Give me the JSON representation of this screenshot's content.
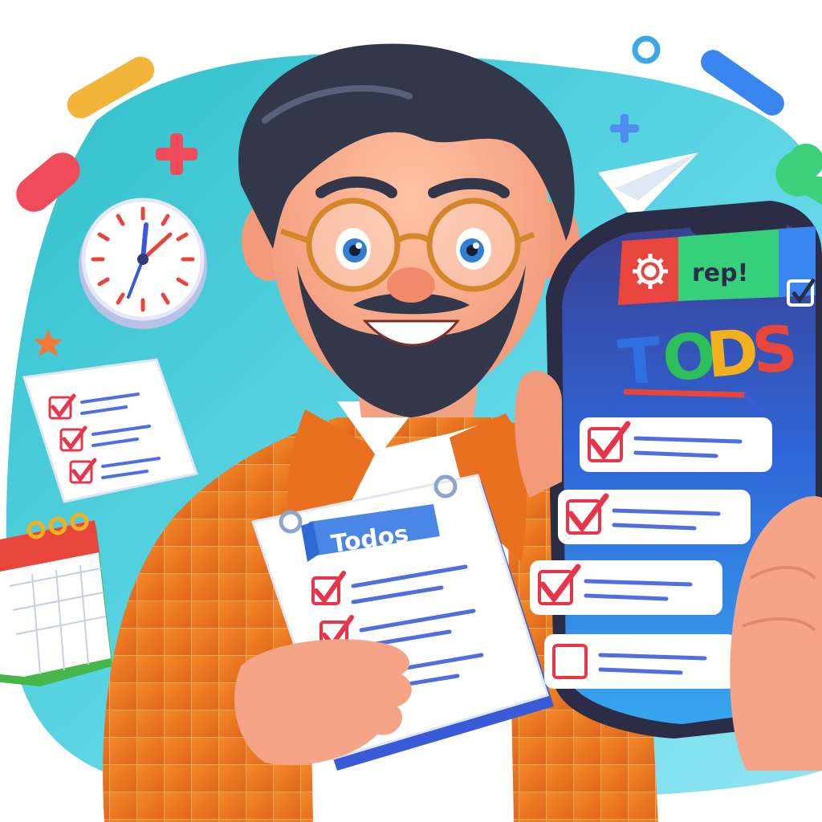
{
  "notepad": {
    "banner_text": "Todos"
  },
  "phone": {
    "tab_middle_text": "rep!",
    "title_letters": [
      "T",
      "O",
      "D",
      "S"
    ],
    "title_colors": [
      "#2f6fe0",
      "#2fbf5a",
      "#f2b01e",
      "#e8453c"
    ],
    "tab_colors": [
      "#e8453c",
      "#37d07a",
      "#3a86f0"
    ],
    "todo_items": [
      {
        "checked": true
      },
      {
        "checked": true
      },
      {
        "checked": true
      },
      {
        "checked": false
      }
    ]
  },
  "paper_note": {
    "rows": [
      {
        "checked": true
      },
      {
        "checked": true
      },
      {
        "checked": true
      }
    ]
  },
  "icons": [
    "clock-icon",
    "calendar-icon",
    "paper-plane-icon",
    "gear-icon",
    "checkbox-icon",
    "sparkle-icon"
  ],
  "colors": {
    "background_blob": "#3ec9d8",
    "jacket": "#f07a1e",
    "check_red": "#e8354a",
    "list_lines": "#4f6fe0"
  }
}
